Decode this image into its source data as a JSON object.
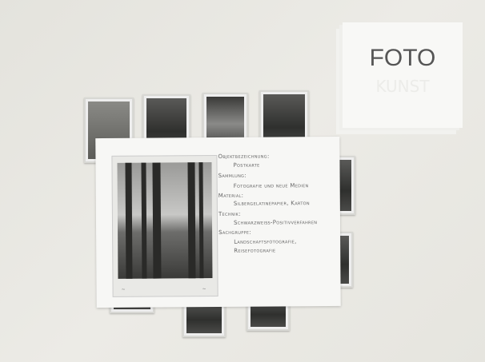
{
  "sign": {
    "title": "FOTO",
    "faint_text": "KUNST"
  },
  "card": {
    "fields": [
      {
        "label": "Objektbezeichnung:",
        "value": "Postkarte"
      },
      {
        "label": "Sammlung:",
        "value": "Fotografie und neue Medien"
      },
      {
        "label": "Material:",
        "value": "Silbergelatinepapier, Karton"
      },
      {
        "label": "Technik:",
        "value": "Schwarzweiß-Positivverfahren"
      },
      {
        "label": "Sachgruppe:",
        "value": "Landschaftsfotografie,"
      },
      {
        "label": "",
        "value": "Reisefotografie"
      }
    ]
  }
}
